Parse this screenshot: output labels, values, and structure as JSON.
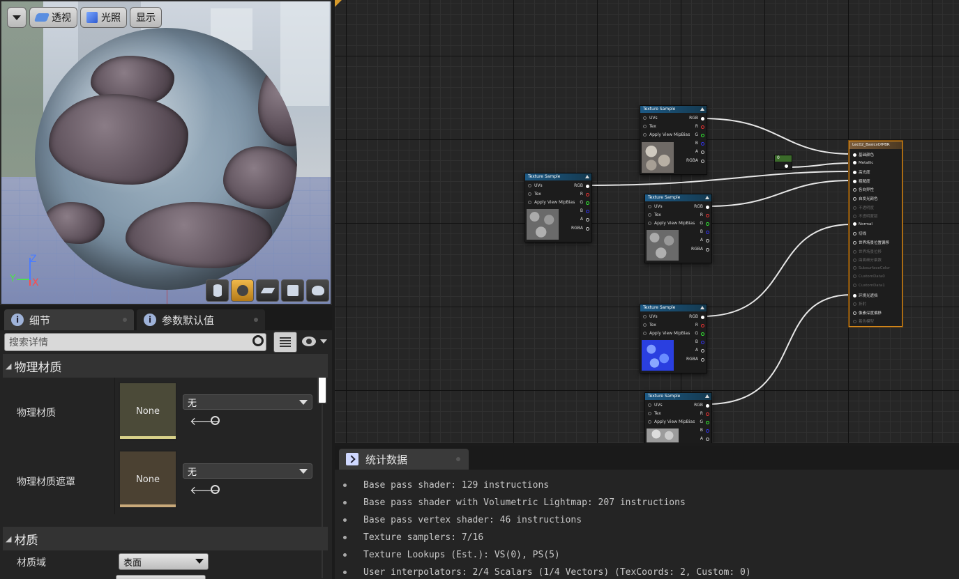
{
  "viewport": {
    "toolbar": {
      "perspective": "透视",
      "lit": "光照",
      "show": "显示"
    },
    "axis": {
      "z": "Z",
      "x": "X",
      "y": "Y"
    }
  },
  "details": {
    "tabs": [
      {
        "label": "细节"
      },
      {
        "label": "参数默认值"
      }
    ],
    "search_placeholder": "搜索详情",
    "sections": {
      "physical_material": {
        "header": "物理材质",
        "rows": [
          {
            "label": "物理材质",
            "thumb": "None",
            "value": "无"
          },
          {
            "label": "物理材质遮罩",
            "thumb": "None",
            "value": "无"
          }
        ]
      },
      "material": {
        "header": "材质",
        "rows": [
          {
            "label": "材质域",
            "value": "表面"
          }
        ]
      }
    }
  },
  "graph": {
    "texture_nodes": [
      {
        "title": "Texture Sample",
        "pins_in": [
          "UVs",
          "Tex",
          "Apply View MipBias"
        ],
        "pins_out": [
          "RGB",
          "R",
          "G",
          "B",
          "A",
          "RGBA"
        ],
        "texture": "stone"
      },
      {
        "title": "Texture Sample",
        "pins_in": [
          "UVs",
          "Tex",
          "Apply View MipBias"
        ],
        "pins_out": [
          "RGB",
          "R",
          "G",
          "B",
          "A",
          "RGBA"
        ],
        "texture": "grey"
      },
      {
        "title": "Texture Sample",
        "pins_in": [
          "UVs",
          "Tex",
          "Apply View MipBias"
        ],
        "pins_out": [
          "RGB",
          "R",
          "G",
          "B",
          "A",
          "RGBA"
        ],
        "texture": "grey"
      },
      {
        "title": "Texture Sample",
        "pins_in": [
          "UVs",
          "Tex",
          "Apply View MipBias"
        ],
        "pins_out": [
          "RGB",
          "R",
          "G",
          "B",
          "A",
          "RGBA"
        ],
        "texture": "normal"
      },
      {
        "title": "Texture Sample",
        "pins_in": [
          "UVs",
          "Tex",
          "Apply View MipBias"
        ],
        "pins_out": [
          "RGB",
          "R",
          "G",
          "B",
          "A"
        ],
        "texture": "light"
      }
    ],
    "constant": {
      "value": "0"
    },
    "result": {
      "title": "Lec02_BasicsOfPBR",
      "pins": [
        {
          "label": "基础颜色",
          "state": "on"
        },
        {
          "label": "Metallic",
          "state": "on"
        },
        {
          "label": "高光度",
          "state": "on"
        },
        {
          "label": "粗糙度",
          "state": "on"
        },
        {
          "label": "各向异性",
          "state": "idle"
        },
        {
          "label": "自发光颜色",
          "state": "idle"
        },
        {
          "label": "不透明度",
          "state": "off"
        },
        {
          "label": "不透明蒙版",
          "state": "off"
        },
        {
          "label": "Normal",
          "state": "on"
        },
        {
          "label": "切线",
          "state": "idle"
        },
        {
          "label": "世界场景位置偏移",
          "state": "idle"
        },
        {
          "label": "世界场景位移",
          "state": "off"
        },
        {
          "label": "曲面细分乘数",
          "state": "off"
        },
        {
          "label": "SubsurfaceColor",
          "state": "off"
        },
        {
          "label": "CustomData0",
          "state": "off"
        },
        {
          "label": "CustomData1",
          "state": "off"
        },
        {
          "label": "环境光遮挡",
          "state": "on"
        },
        {
          "label": "折射",
          "state": "off"
        },
        {
          "label": "像素深度偏移",
          "state": "idle"
        },
        {
          "label": "着色模型",
          "state": "off"
        }
      ]
    }
  },
  "stats": {
    "tab_label": "统计数据",
    "lines": [
      "Base pass shader: 129 instructions",
      "Base pass shader with Volumetric Lightmap: 207 instructions",
      "Base pass vertex shader: 46 instructions",
      "Texture samplers: 7/16",
      "Texture Lookups (Est.): VS(0), PS(5)",
      "User interpolators: 2/4 Scalars (1/4 Vectors) (TexCoords: 2, Custom: 0)"
    ]
  }
}
